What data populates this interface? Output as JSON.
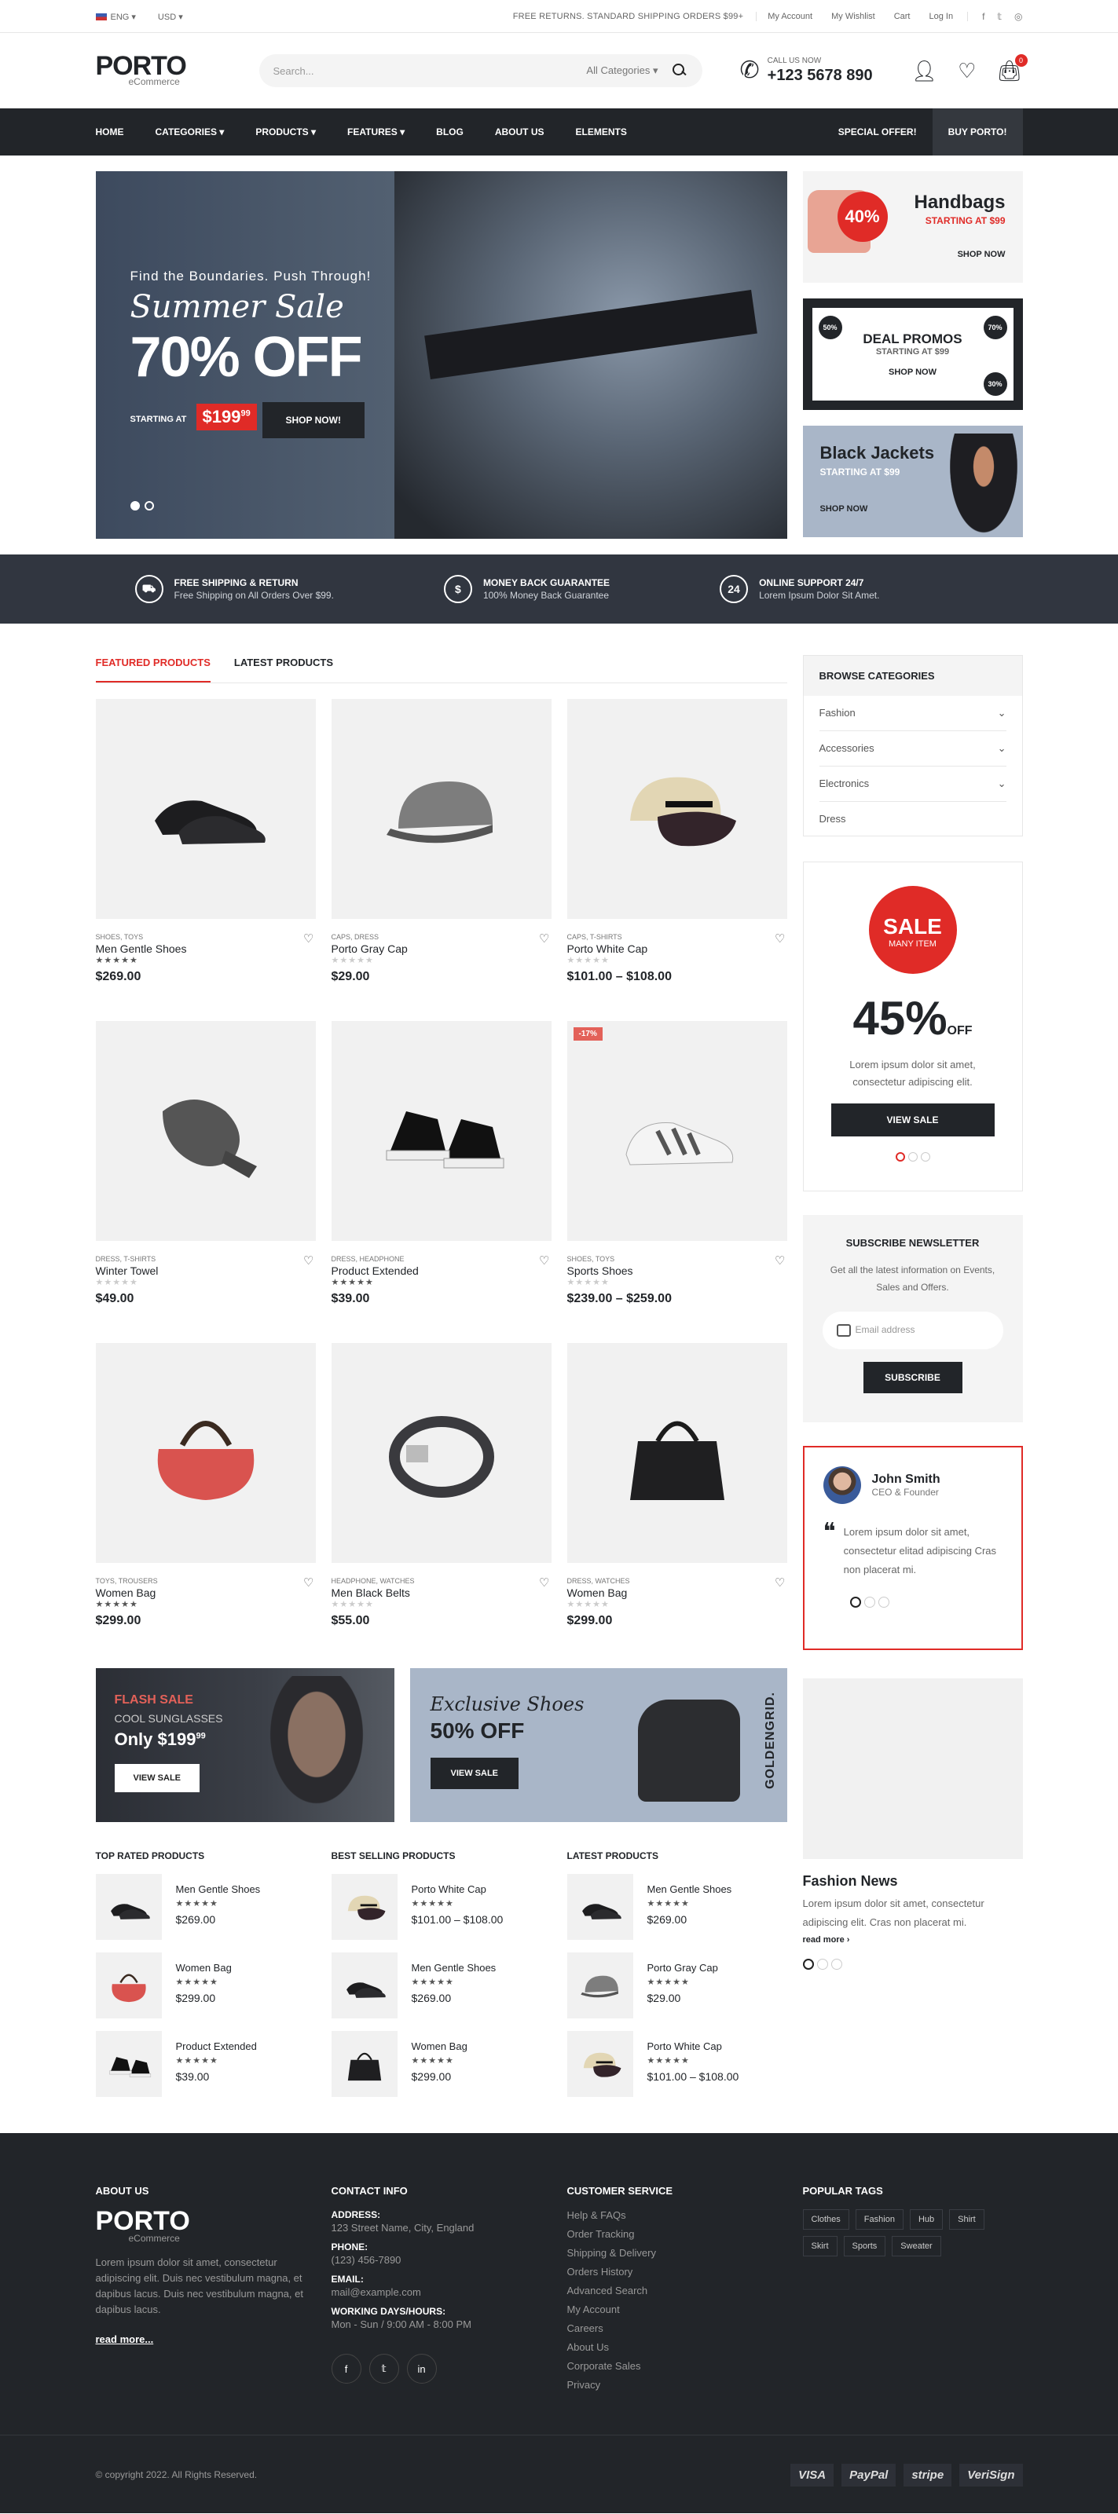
{
  "topbar": {
    "lang": "ENG",
    "currency": "USD",
    "message": "FREE RETURNS. STANDARD SHIPPING ORDERS $99+",
    "links": [
      "My Account",
      "My Wishlist",
      "Cart",
      "Log In"
    ]
  },
  "header": {
    "logo": "PORTO",
    "logo_sub": "eCommerce",
    "search_placeholder": "Search...",
    "search_category": "All Categories",
    "call_label": "CALL US NOW",
    "phone": "+123 5678 890",
    "cart_count": "0"
  },
  "nav": {
    "items": [
      "HOME",
      "CATEGORIES",
      "PRODUCTS",
      "FEATURES",
      "BLOG",
      "ABOUT US",
      "ELEMENTS"
    ],
    "special": "SPECIAL OFFER!",
    "buy": "BUY PORTO!"
  },
  "hero": {
    "line1": "Find the Boundaries. Push Through!",
    "line2": "Summer Sale",
    "line3": "70% OFF",
    "starting": "STARTING AT",
    "price": "$199",
    "price_cents": "99",
    "button": "SHOP NOW!"
  },
  "banners": {
    "b1": {
      "circle": "40%",
      "title": "Handbags",
      "sub": "STARTING AT $99",
      "link": "SHOP NOW"
    },
    "b2": {
      "title": "DEAL PROMOS",
      "sub": "STARTING AT $99",
      "link": "SHOP NOW",
      "c1": "50%",
      "c2": "70%",
      "c3": "30%"
    },
    "b3": {
      "title": "Black Jackets",
      "sub": "STARTING AT $99",
      "link": "SHOP NOW"
    }
  },
  "info": [
    {
      "icon": "truck-icon",
      "glyph": "⛟",
      "title": "FREE SHIPPING & RETURN",
      "text": "Free Shipping on All Orders Over $99."
    },
    {
      "icon": "dollar-icon",
      "glyph": "$",
      "title": "MONEY BACK GUARANTEE",
      "text": "100% Money Back Guarantee"
    },
    {
      "icon": "support-24-icon",
      "glyph": "24",
      "title": "ONLINE SUPPORT 24/7",
      "text": "Lorem Ipsum Dolor Sit Amet."
    }
  ],
  "tabs": [
    "FEATURED PRODUCTS",
    "LATEST PRODUCTS"
  ],
  "products": [
    {
      "cat": "SHOES, TOYS",
      "name": "Men Gentle Shoes",
      "price": "$269.00",
      "rating": 5,
      "sale": ""
    },
    {
      "cat": "CAPS, DRESS",
      "name": "Porto Gray Cap",
      "price": "$29.00",
      "rating": 0,
      "sale": ""
    },
    {
      "cat": "CAPS, T-SHIRTS",
      "name": "Porto White Cap",
      "price": "$101.00 – $108.00",
      "rating": 0,
      "sale": ""
    },
    {
      "cat": "DRESS, T-SHIRTS",
      "name": "Winter Towel",
      "price": "$49.00",
      "rating": 0,
      "sale": ""
    },
    {
      "cat": "DRESS, HEADPHONE",
      "name": "Product Extended",
      "price": "$39.00",
      "rating": 5,
      "sale": ""
    },
    {
      "cat": "SHOES, TOYS",
      "name": "Sports Shoes",
      "price": "$239.00 – $259.00",
      "rating": 0,
      "sale": "-17%"
    },
    {
      "cat": "TOYS, TROUSERS",
      "name": "Women Bag",
      "price": "$299.00",
      "rating": 5,
      "sale": ""
    },
    {
      "cat": "HEADPHONE, WATCHES",
      "name": "Men Black Belts",
      "price": "$55.00",
      "rating": 0,
      "sale": ""
    },
    {
      "cat": "DRESS, WATCHES",
      "name": "Women Bag",
      "price": "$299.00",
      "rating": 0,
      "sale": ""
    }
  ],
  "promo1": {
    "title": "FLASH SALE",
    "sub": "COOL SUNGLASSES",
    "price": "Only $199",
    "cents": "99",
    "button": "VIEW SALE"
  },
  "promo2": {
    "title": "Exclusive Shoes",
    "sub": "50% OFF",
    "button": "VIEW SALE",
    "brand": "GOLDENGRID."
  },
  "lists": [
    {
      "title": "TOP RATED PRODUCTS",
      "items": [
        {
          "name": "Men Gentle Shoes",
          "price": "$269.00"
        },
        {
          "name": "Women Bag",
          "price": "$299.00"
        },
        {
          "name": "Product Extended",
          "price": "$39.00"
        }
      ]
    },
    {
      "title": "BEST SELLING PRODUCTS",
      "items": [
        {
          "name": "Porto White Cap",
          "price": "$101.00 – $108.00"
        },
        {
          "name": "Men Gentle Shoes",
          "price": "$269.00"
        },
        {
          "name": "Women Bag",
          "price": "$299.00"
        }
      ]
    },
    {
      "title": "LATEST PRODUCTS",
      "items": [
        {
          "name": "Men Gentle Shoes",
          "price": "$269.00"
        },
        {
          "name": "Porto Gray Cap",
          "price": "$29.00"
        },
        {
          "name": "Porto White Cap",
          "price": "$101.00 – $108.00"
        }
      ]
    }
  ],
  "sidebar": {
    "cats_title": "BROWSE CATEGORIES",
    "cats": [
      "Fashion",
      "Accessories",
      "Electronics",
      "Dress"
    ],
    "sale_title": "SALE",
    "sale_sub": "MANY ITEM",
    "sale_pct": "45%",
    "sale_off": "OFF",
    "sale_text": "Lorem ipsum dolor sit amet, consectetur adipiscing elit.",
    "sale_btn": "VIEW SALE",
    "news_title": "SUBSCRIBE NEWSLETTER",
    "news_text": "Get all the latest information on Events, Sales and Offers.",
    "news_placeholder": "Email address",
    "news_btn": "SUBSCRIBE",
    "testi_name": "John Smith",
    "testi_role": "CEO & Founder",
    "testi_text": "Lorem ipsum dolor sit amet, consectetur elitad adipiscing Cras non placerat mi.",
    "fn_title": "Fashion News",
    "fn_text": "Lorem ipsum dolor sit amet, consectetur adipiscing elit. Cras non placerat mi.",
    "fn_more": "read more ›"
  },
  "footer": {
    "about_title": "ABOUT US",
    "about_text": "Lorem ipsum dolor sit amet, consectetur adipiscing elit. Duis nec vestibulum magna, et dapibus lacus. Duis nec vestibulum magna, et dapibus lacus.",
    "read_more": "read more...",
    "contact_title": "CONTACT INFO",
    "contact": [
      {
        "l": "ADDRESS:",
        "v": "123 Street Name, City, England"
      },
      {
        "l": "PHONE:",
        "v": "(123) 456-7890"
      },
      {
        "l": "EMAIL:",
        "v": "mail@example.com"
      },
      {
        "l": "WORKING DAYS/HOURS:",
        "v": "Mon - Sun / 9:00 AM - 8:00 PM"
      }
    ],
    "cs_title": "CUSTOMER SERVICE",
    "cs": [
      "Help & FAQs",
      "Order Tracking",
      "Shipping & Delivery",
      "Orders History",
      "Advanced Search",
      "My Account",
      "Careers",
      "About Us",
      "Corporate Sales",
      "Privacy"
    ],
    "tags_title": "POPULAR TAGS",
    "tags": [
      "Clothes",
      "Fashion",
      "Hub",
      "Shirt",
      "Skirt",
      "Sports",
      "Sweater"
    ],
    "copyright": "© copyright 2022. All Rights Reserved.",
    "payments": [
      "VISA",
      "PayPal",
      "stripe",
      "VeriSign"
    ]
  }
}
